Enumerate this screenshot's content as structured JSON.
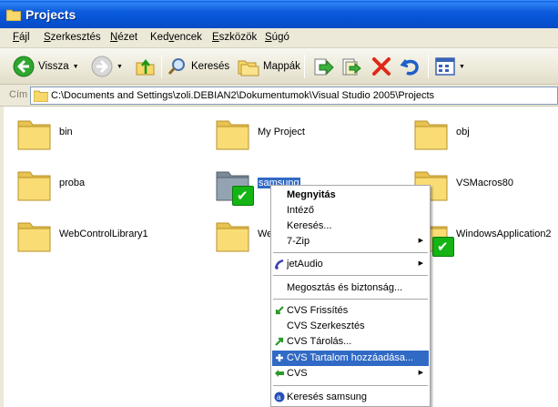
{
  "window": {
    "title": "Projects"
  },
  "menu": [
    {
      "label": "Fájl",
      "u": "F",
      "rest": "ájl"
    },
    {
      "label": "Szerkesztés",
      "u": "S",
      "rest": "zerkesztés"
    },
    {
      "label": "Nézet",
      "u": "N",
      "rest": "ézet"
    },
    {
      "label": "Kedvencek",
      "u": "v",
      "pre": "Ked",
      "rest": "encek"
    },
    {
      "label": "Eszközök",
      "u": "E",
      "rest": "szközök"
    },
    {
      "label": "Súgó",
      "u": "S",
      "rest": "úgó"
    }
  ],
  "toolbar": {
    "back_label": "Vissza",
    "search_label": "Keresés",
    "folders_label": "Mappák"
  },
  "address": {
    "label": "Cím",
    "path": "C:\\Documents and Settings\\zoli.DEBIAN2\\Dokumentumok\\Visual Studio 2005\\Projects"
  },
  "items": [
    {
      "name": "bin"
    },
    {
      "name": "My Project"
    },
    {
      "name": "obj"
    },
    {
      "name": "proba"
    },
    {
      "name": "samsung"
    },
    {
      "name": "VSMacros80"
    },
    {
      "name": "WebControlLibrary1"
    },
    {
      "name": "We"
    },
    {
      "name": "WindowsApplication2"
    }
  ],
  "context_menu": {
    "open": "Megnyitás",
    "explore": "Intéző",
    "search": "Keresés...",
    "zip": "7-Zip",
    "jetaudio": "jetAudio",
    "sharing": "Megosztás és biztonság...",
    "cvs_update": "CVS Frissítés",
    "cvs_edit": "CVS Szerkesztés",
    "cvs_commit": "CVS Tárolás...",
    "cvs_add": "CVS Tartalom hozzáadása...",
    "cvs": "CVS",
    "search_samsung": "Keresés samsung"
  },
  "colors": {
    "titlebar": "#0553d4",
    "selection": "#316ac5",
    "cvs_badge": "#13b413",
    "folder": "#f7d86a"
  }
}
